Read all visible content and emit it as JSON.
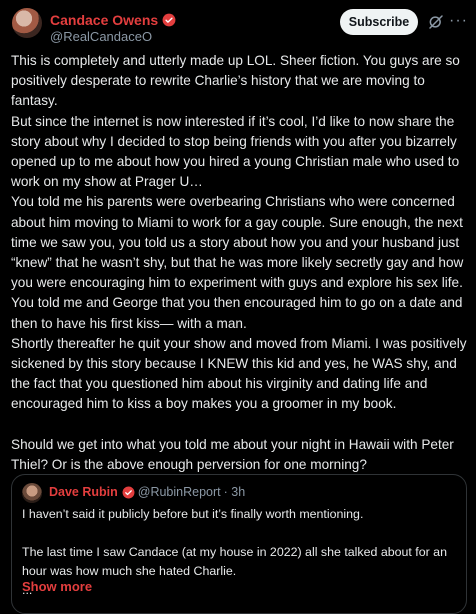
{
  "author": {
    "name": "Candace Owens",
    "handle": "@RealCandaceO",
    "verified_color": "#e33e3e"
  },
  "actions": {
    "subscribe_label": "Subscribe",
    "grok_icon": "grok-icon",
    "more_icon": "more-icon"
  },
  "post": {
    "lines": [
      "This is completely and utterly made up LOL. Sheer fiction. You guys are so positively desperate to rewrite Charlie’s history that we are moving to fantasy.",
      "But since the internet is now interested if it’s cool, I’d like to now share the story about why I decided to stop being friends with you after you bizarrely opened up to me about how you hired a young Christian male who used to work on my show at Prager U…",
      "You told me his parents were overbearing Christians who were concerned about him moving to Miami to work for a gay couple. Sure enough, the next time we saw you, you told us a story about how you and your husband just “knew” that he wasn’t shy, but that he was more likely secretly gay and how you were encouraging him to experiment with guys and explore his sex life. You told me and George that you then encouraged him to go on a date and then to have his first kiss— with a man.",
      "Shortly thereafter he quit your show and moved from Miami. I was positively sickened by this story because I KNEW this kid and yes, he WAS shy, and the fact that you questioned him about his virginity and dating life and encouraged him to kiss a boy makes you a groomer in my book.",
      "Should we get into what you told me about your night in Hawaii with Peter Thiel? Or is the above enough perversion for one morning?"
    ]
  },
  "quote": {
    "name": "Dave Rubin",
    "handle": "@RubinReport",
    "time": "· 3h",
    "line1": "I haven’t said it publicly before but it’s finally worth mentioning.",
    "line2": "The last time I saw Candace (at my house in 2022) all she talked about for an hour was how much she hated Charlie.",
    "ellipsis": "...",
    "show_more": "Show more"
  }
}
